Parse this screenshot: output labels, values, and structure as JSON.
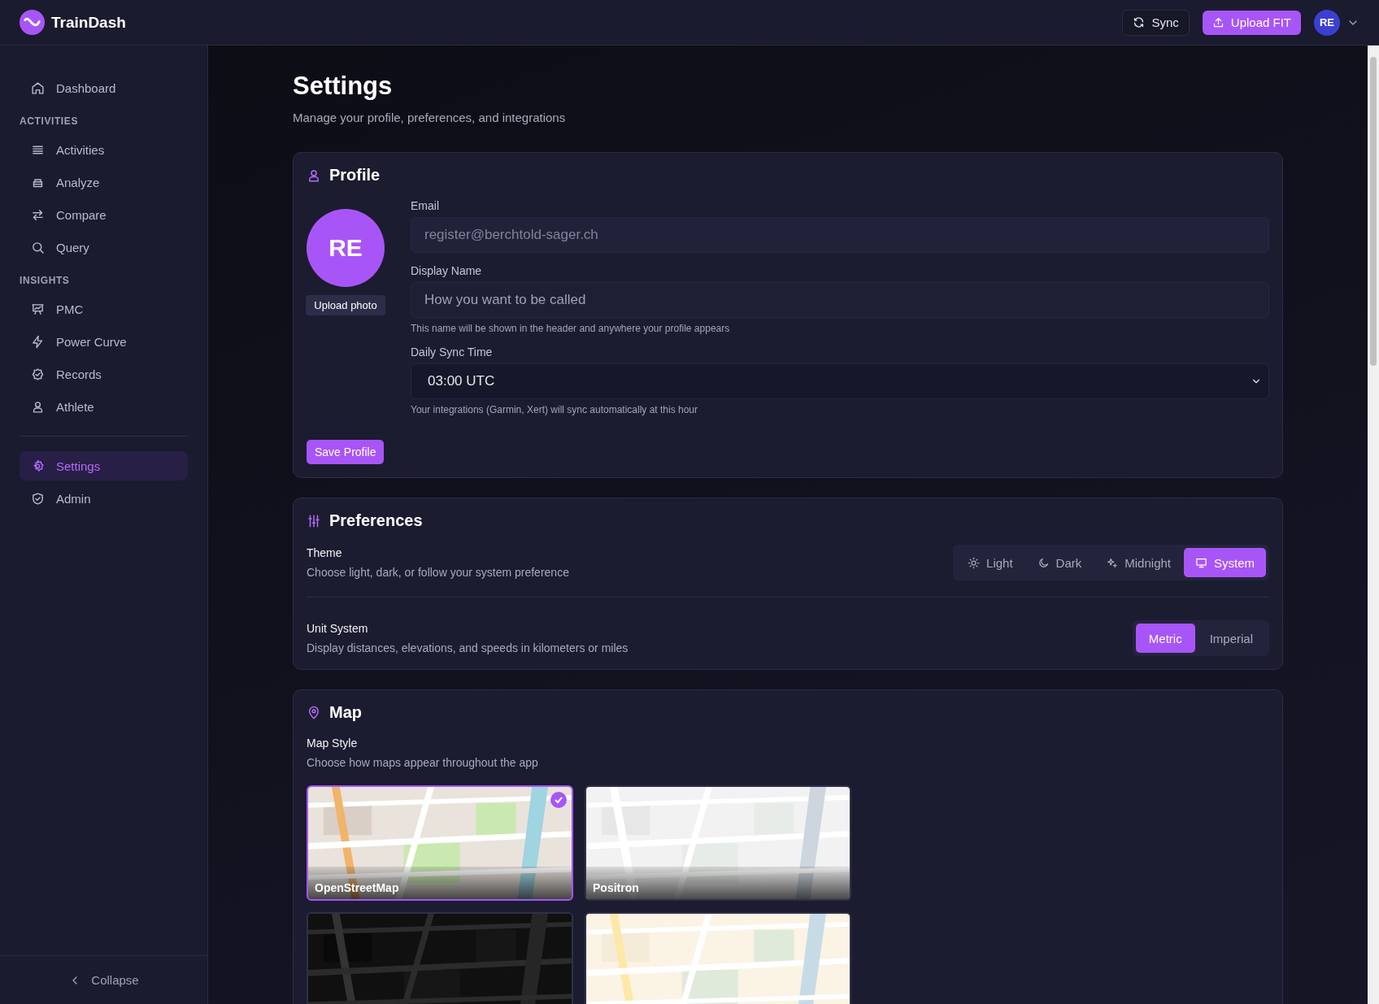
{
  "app": {
    "name": "TrainDash"
  },
  "topbar": {
    "sync": "Sync",
    "upload": "Upload FIT",
    "avatar": "RE"
  },
  "sidebar": {
    "groups": [
      {
        "items": [
          {
            "label": "Dashboard",
            "selected": false
          }
        ]
      },
      {
        "heading": "ACTIVITIES",
        "items": [
          {
            "label": "Activities",
            "selected": false
          },
          {
            "label": "Analyze",
            "selected": false
          },
          {
            "label": "Compare",
            "selected": false
          },
          {
            "label": "Query",
            "selected": false
          }
        ]
      },
      {
        "heading": "INSIGHTS",
        "items": [
          {
            "label": "PMC",
            "selected": false
          },
          {
            "label": "Power Curve",
            "selected": false
          },
          {
            "label": "Records",
            "selected": false
          },
          {
            "label": "Athlete",
            "selected": false
          }
        ]
      },
      {
        "items": [
          {
            "label": "Settings",
            "selected": true
          },
          {
            "label": "Admin",
            "selected": false
          }
        ]
      }
    ],
    "collapse": "Collapse"
  },
  "page": {
    "title": "Settings",
    "subtitle": "Manage your profile, preferences, and integrations"
  },
  "profile": {
    "title": "Profile",
    "initials": "RE",
    "upload": "Upload photo",
    "email": {
      "label": "Email",
      "value": "register@berchtold-sager.ch",
      "disabled": true
    },
    "display_name": {
      "label": "Display Name",
      "placeholder": "How you want to be called",
      "help": "This name will be shown in the header and anywhere your profile appears"
    },
    "sync_time": {
      "label": "Daily Sync Time",
      "value": "03:00 UTC",
      "help": "Your integrations (Garmin, Xert) will sync automatically at this hour"
    },
    "save": "Save Profile"
  },
  "preferences": {
    "title": "Preferences",
    "theme": {
      "label": "Theme",
      "description": "Choose light, dark, or follow your system preference",
      "options": [
        {
          "label": "Light",
          "selected": false
        },
        {
          "label": "Dark",
          "selected": false
        },
        {
          "label": "Midnight",
          "selected": false
        },
        {
          "label": "System",
          "selected": true
        }
      ]
    },
    "units": {
      "label": "Unit System",
      "description": "Display distances, elevations, and speeds in kilometers or miles",
      "options": [
        {
          "label": "Metric",
          "selected": true
        },
        {
          "label": "Imperial",
          "selected": false
        }
      ]
    }
  },
  "map": {
    "title": "Map",
    "label": "Map Style",
    "description": "Choose how maps appear throughout the app",
    "styles": [
      {
        "label": "OpenStreetMap",
        "selected": true,
        "kind": "picture"
      },
      {
        "label": "Positron",
        "selected": false,
        "kind": "picture"
      },
      {
        "selected": false,
        "kind": "picture"
      },
      {
        "selected": false,
        "kind": "picture"
      }
    ]
  }
}
